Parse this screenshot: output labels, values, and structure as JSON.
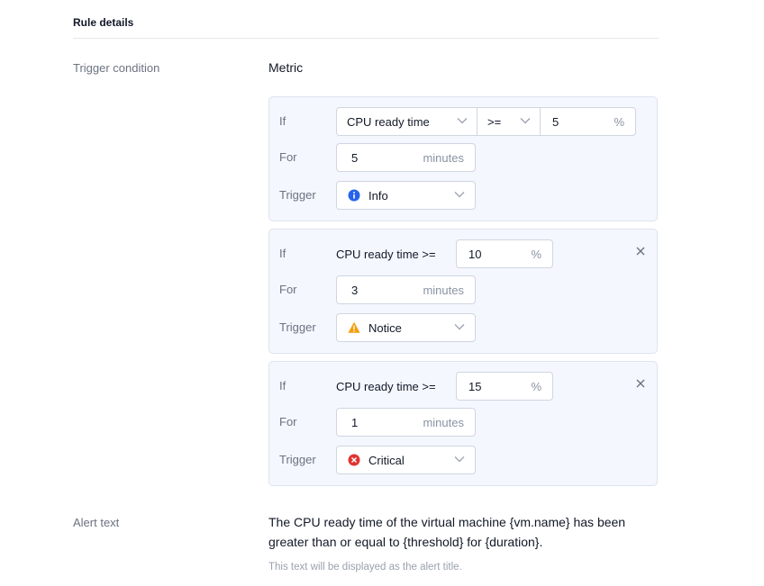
{
  "section": {
    "title": "Rule details"
  },
  "trigger_condition": {
    "label": "Trigger condition",
    "metric_label": "Metric",
    "blocks": [
      {
        "if_label": "If",
        "metric": "CPU ready time",
        "operator": ">=",
        "threshold": "5",
        "threshold_unit": "%",
        "for_label": "For",
        "duration": "5",
        "duration_unit": "minutes",
        "trigger_label": "Trigger",
        "severity": "Info",
        "severity_color": "#2563eb"
      },
      {
        "if_label": "If",
        "condition_text": "CPU ready time >=",
        "threshold": "10",
        "threshold_unit": "%",
        "for_label": "For",
        "duration": "3",
        "duration_unit": "minutes",
        "trigger_label": "Trigger",
        "severity": "Notice",
        "severity_color": "#f59e0b"
      },
      {
        "if_label": "If",
        "condition_text": "CPU ready time >=",
        "threshold": "15",
        "threshold_unit": "%",
        "for_label": "For",
        "duration": "1",
        "duration_unit": "minutes",
        "trigger_label": "Trigger",
        "severity": "Critical",
        "severity_color": "#e0342f"
      }
    ]
  },
  "alert": {
    "label": "Alert text",
    "text": "The CPU ready time of the virtual machine {vm.name} has been greater than or equal to {threshold} for {duration}.",
    "hint": "This text will be displayed as the alert title."
  },
  "icons": {
    "chevron": "chevron-down-icon",
    "close": "close-icon",
    "info": "info-icon",
    "notice": "warning-icon",
    "critical": "error-icon"
  }
}
